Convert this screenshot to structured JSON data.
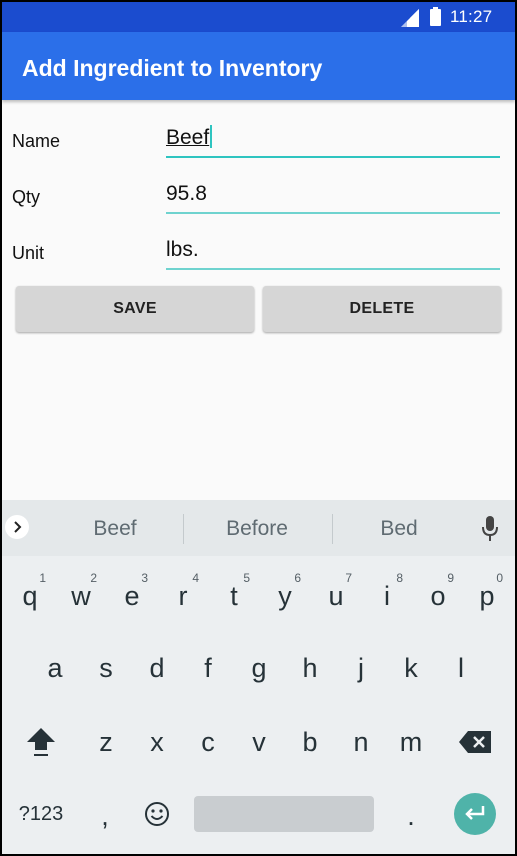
{
  "status_bar": {
    "time": "11:27"
  },
  "app_bar": {
    "title": "Add Ingredient to Inventory"
  },
  "form": {
    "name": {
      "label": "Name",
      "value": "Beef"
    },
    "qty": {
      "label": "Qty",
      "value": "95.8"
    },
    "unit": {
      "label": "Unit",
      "value": "lbs."
    }
  },
  "buttons": {
    "save": "SAVE",
    "delete": "DELETE"
  },
  "keyboard": {
    "suggestions": [
      "Beef",
      "Before",
      "Bed"
    ],
    "row1": [
      {
        "key": "q",
        "hint": "1"
      },
      {
        "key": "w",
        "hint": "2"
      },
      {
        "key": "e",
        "hint": "3"
      },
      {
        "key": "r",
        "hint": "4"
      },
      {
        "key": "t",
        "hint": "5"
      },
      {
        "key": "y",
        "hint": "6"
      },
      {
        "key": "u",
        "hint": "7"
      },
      {
        "key": "i",
        "hint": "8"
      },
      {
        "key": "o",
        "hint": "9"
      },
      {
        "key": "p",
        "hint": "0"
      }
    ],
    "row2": [
      "a",
      "s",
      "d",
      "f",
      "g",
      "h",
      "j",
      "k",
      "l"
    ],
    "row3": [
      "z",
      "x",
      "c",
      "v",
      "b",
      "n",
      "m"
    ],
    "row4": {
      "symbols": "?123",
      "comma": ",",
      "period": "."
    }
  },
  "colors": {
    "status_bar": "#1b4ccf",
    "app_bar": "#2b6fe9",
    "field_underline": "#6fd3cf",
    "enter_key": "#4fb3a9"
  }
}
